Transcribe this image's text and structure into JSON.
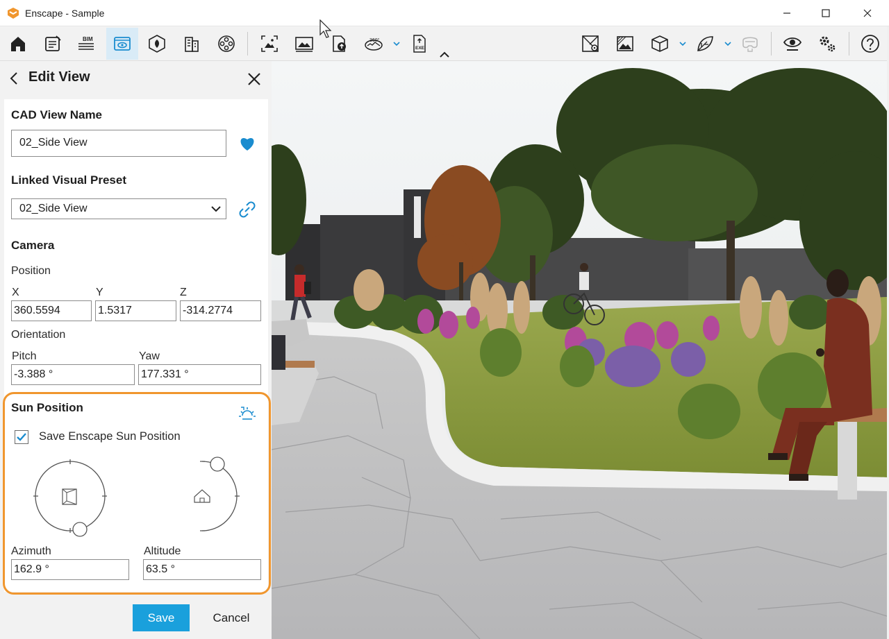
{
  "window": {
    "title": "Enscape - Sample",
    "accent": "#f0962e"
  },
  "toolbar": {
    "left_icons": [
      "home-icon",
      "notes-icon",
      "bim-icon",
      "views-icon",
      "site-context-icon",
      "buildings-icon",
      "asset-library-icon"
    ],
    "bim_label": "BIM",
    "export_icons": [
      "screenshot-icon",
      "batch-render-icon",
      "upload-icon",
      "panorama-icon",
      "exe-export-icon"
    ],
    "panorama_label": "360°",
    "exe_label": "EXE",
    "right_icons": [
      "map-icon",
      "atmosphere-icon",
      "section-box-icon",
      "material-editor-icon",
      "vr-headset-icon",
      "visibility-icon",
      "settings-icon",
      "help-icon"
    ],
    "active_icon": "views-icon"
  },
  "panel": {
    "title": "Edit View",
    "cad_view_name": {
      "label": "CAD View Name",
      "value": "02_Side View"
    },
    "linked_preset": {
      "label": "Linked Visual Preset",
      "value": "02_Side View"
    },
    "camera": {
      "label": "Camera",
      "position_label": "Position",
      "x_label": "X",
      "x": "360.5594",
      "y_label": "Y",
      "y": "1.5317",
      "z_label": "Z",
      "z": "-314.2774",
      "orientation_label": "Orientation",
      "pitch_label": "Pitch",
      "pitch": "-3.388 °",
      "yaw_label": "Yaw",
      "yaw": "177.331 °"
    },
    "sun": {
      "label": "Sun Position",
      "save_checkbox_label": "Save Enscape Sun Position",
      "save_checked": true,
      "azimuth_label": "Azimuth",
      "azimuth": "162.9 °",
      "altitude_label": "Altitude",
      "altitude": "63.5 °"
    },
    "save_label": "Save",
    "cancel_label": "Cancel",
    "primary_color": "#1aa0dc"
  }
}
